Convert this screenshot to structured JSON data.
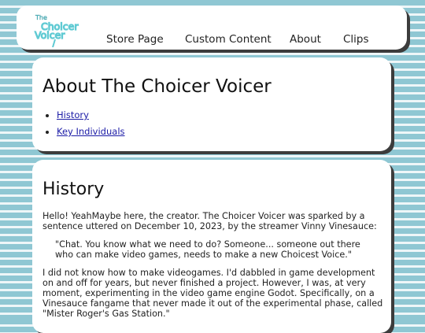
{
  "logo": {
    "line1": "The",
    "line2": "Choicer",
    "line3": "Voicer"
  },
  "nav": {
    "items": [
      {
        "label": "Store Page"
      },
      {
        "label": "Custom Content"
      },
      {
        "label": "About"
      },
      {
        "label": "Clips"
      }
    ]
  },
  "about": {
    "title": "About The Choicer Voicer",
    "links": [
      "History",
      "Key Individuals"
    ]
  },
  "history": {
    "title": "History",
    "intro": "Hello! YeahMaybe here, the creator. The Choicer Voicer was sparked by a sentence uttered on December 10, 2023, by the streamer Vinny Vinesauce:",
    "quote": "\"Chat. You know what we need to do? Someone... someone out there who can make video games, needs to make a new Choicest Voice.\"",
    "body": "I did not know how to make videogames. I'd dabbled in game development on and off for years, but never finished a project. However, I was, at very moment, experimenting in the video game engine Godot. Specifically, on a Vinesauce fangame that never made it out of the experimental phase, called \"Mister Roger's Gas Station.\""
  },
  "colors": {
    "stripe_dark": "#8fc7d3",
    "stripe_light": "#eef6f8",
    "logo_teal": "#5fcad3",
    "link": "#1a1aa6",
    "shadow": "#3c3c3c"
  }
}
